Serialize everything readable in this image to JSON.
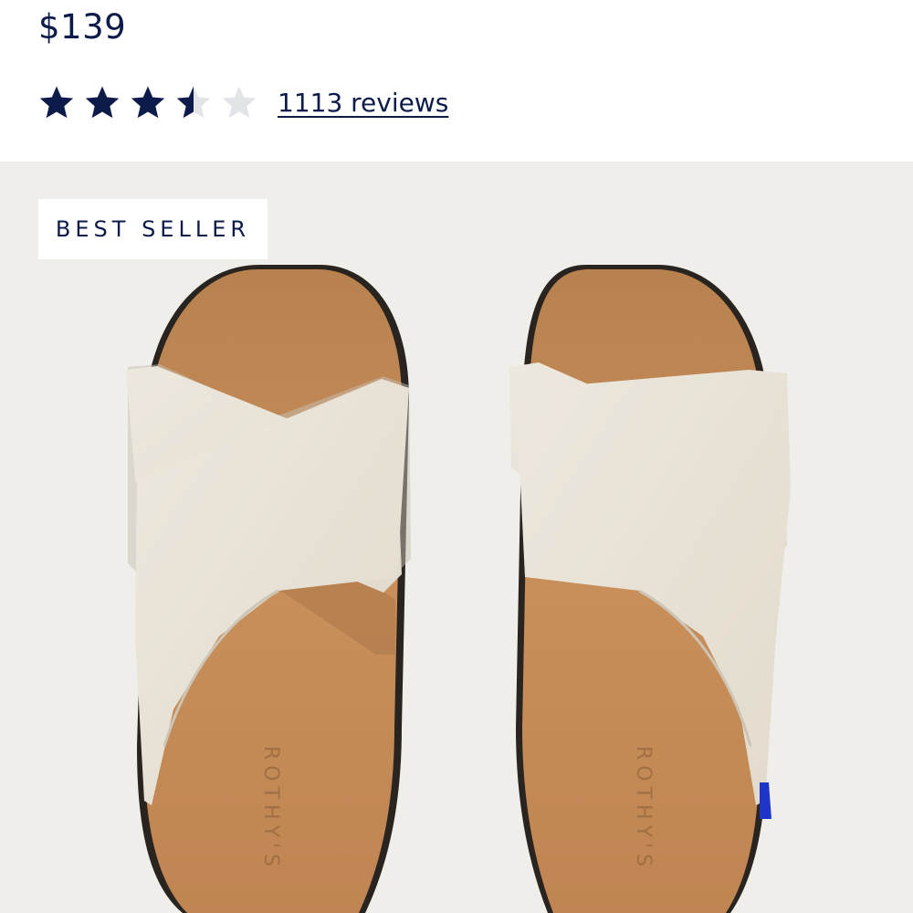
{
  "product": {
    "price": "$139",
    "rating": 3.5,
    "rating_max": 5,
    "reviews_label": "1113 reviews",
    "badge": "BEST SELLER",
    "brand_imprint": "ROTHY'S"
  },
  "icons": {
    "star": "star-icon",
    "star_half": "star-half-icon",
    "star_empty": "star-empty-icon"
  },
  "colors": {
    "navy": "#0d1b4a",
    "star_empty": "#e3e4e8",
    "hero_bg": "#efeeeb",
    "footbed": "#c48a55",
    "strap": "#e9e3d8"
  }
}
